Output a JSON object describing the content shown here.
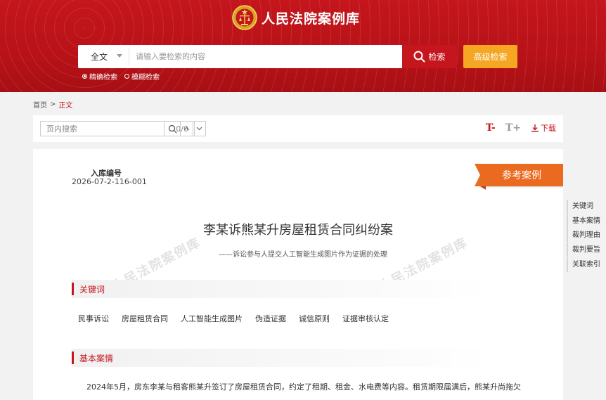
{
  "header": {
    "site_name": "人民法院案例库",
    "search": {
      "scope": "全文",
      "placeholder": "请输入要检索的内容",
      "search_label": "检索",
      "advanced_label": "高级检索",
      "modes": [
        {
          "label": "精确检索",
          "selected": true
        },
        {
          "label": "模糊检索",
          "selected": false
        }
      ]
    }
  },
  "breadcrumb": {
    "home": "首页",
    "separator": ">",
    "current": "正文"
  },
  "toolbar": {
    "find_placeholder": "页内搜索",
    "find_count": "0/0",
    "decrease_font": "T-",
    "increase_font": "T+",
    "download": "下载"
  },
  "case": {
    "reg_label": "入库编号",
    "reg_no": "2026-07-2-116-001",
    "tag": "参考案例",
    "title": "李某诉熊某升房屋租赁合同纠纷案",
    "subtitle": "——诉讼参与人提交人工智能生成图片作为证据的处理",
    "watermark": "人民法院案例库",
    "sections": {
      "keywords_title": "关键词",
      "basic_title": "基本案情"
    },
    "keywords": [
      "民事诉讼",
      "房屋租赁合同",
      "人工智能生成图片",
      "伪造证据",
      "诚信原则",
      "证据审核认定"
    ],
    "basic_text": "2024年5月，房东李某与租客熊某升签订了房屋租赁合同，约定了租期、租金、水电费等内容。租赁期限届满后，熊某升尚拖欠"
  },
  "sidenav": {
    "items": [
      "关键词",
      "基本案情",
      "裁判理由",
      "裁判要旨",
      "关联索引"
    ]
  },
  "colors": {
    "brand_red": "#c4161c",
    "advanced_orange": "#f5a623",
    "tag_orange": "#ea6a1f"
  }
}
